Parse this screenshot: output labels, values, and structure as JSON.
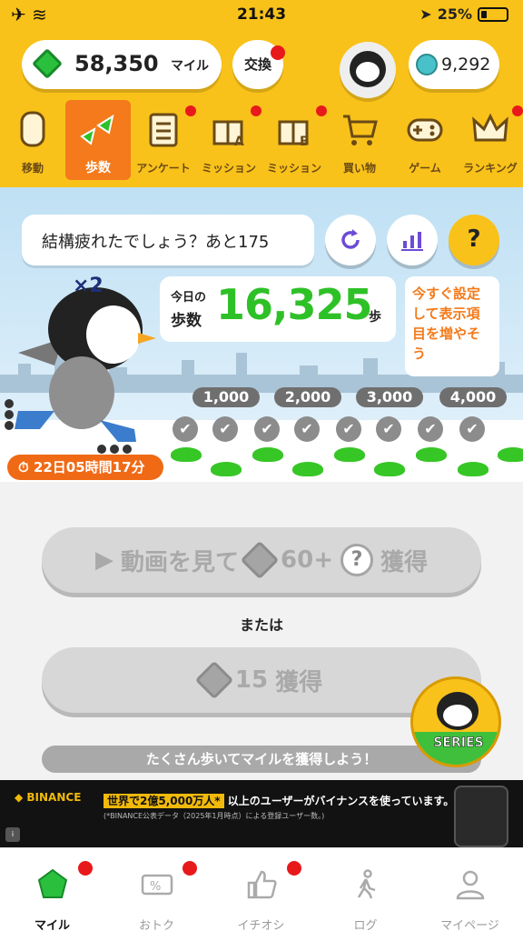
{
  "status_bar": {
    "time": "21:43",
    "battery": "25%",
    "left_icons": "✈ ︎",
    "right_icon": "➤"
  },
  "header": {
    "miles_value": "58,350",
    "miles_unit": "マイル",
    "exchange_label": "交換",
    "coin_value": "9,292"
  },
  "categories": [
    {
      "label": "移動",
      "icon": "cylinder-icon",
      "active": false,
      "dot": false
    },
    {
      "label": "歩数",
      "icon": "footprints-icon",
      "active": true,
      "dot": false
    },
    {
      "label": "アンケート",
      "icon": "clipboard-icon",
      "active": false,
      "dot": true
    },
    {
      "label": "ミッション",
      "icon": "gift-a-icon",
      "active": false,
      "dot": true
    },
    {
      "label": "ミッション",
      "icon": "gift-b-icon",
      "active": false,
      "dot": true
    },
    {
      "label": "買い物",
      "icon": "cart-icon",
      "active": false,
      "dot": false
    },
    {
      "label": "ゲーム",
      "icon": "gamepad-icon",
      "active": false,
      "dot": false
    },
    {
      "label": "ランキング",
      "icon": "crown-icon",
      "active": false,
      "dot": true
    }
  ],
  "scene": {
    "speech": "結構疲れたでしょう？あと175",
    "multiplier": "×2",
    "steps_label_line1": "今日の",
    "steps_label_line2": "歩数",
    "steps_value": "16,325",
    "steps_unit": "歩",
    "tip": "今すぐ設定して表示項目を増やそう",
    "help_glyph": "?",
    "milestones": [
      "1,000",
      "2,000",
      "3,000",
      "4,000"
    ],
    "timer": "22日05時間17分",
    "timer_icon": "⏱"
  },
  "actions": {
    "video_label_pre": "動画を見て",
    "video_amount": "60+",
    "video_suffix": "獲得",
    "or_text": "または",
    "direct_amount": "15",
    "direct_suffix": "獲得",
    "hint": "たくさん歩いてマイルを獲得しよう！",
    "series_label": "SERIES"
  },
  "ad": {
    "brand": "◆ BINANCE",
    "headline_highlight": "世界で2億5,000万人*",
    "headline_rest": " 以上のユーザーがバイナンスを使っています。",
    "note": "(*BINANCE公表データ（2025年1月時点）による登録ユーザー数。)"
  },
  "tabs": [
    {
      "label": "マイル",
      "icon": "gem-icon",
      "active": true,
      "dot": true
    },
    {
      "label": "おトク",
      "icon": "coupon-icon",
      "active": false,
      "dot": true
    },
    {
      "label": "イチオシ",
      "icon": "thumbs-up-icon",
      "active": false,
      "dot": true
    },
    {
      "label": "ログ",
      "icon": "walker-icon",
      "active": false,
      "dot": false
    },
    {
      "label": "マイページ",
      "icon": "person-icon",
      "active": false,
      "dot": false
    }
  ]
}
